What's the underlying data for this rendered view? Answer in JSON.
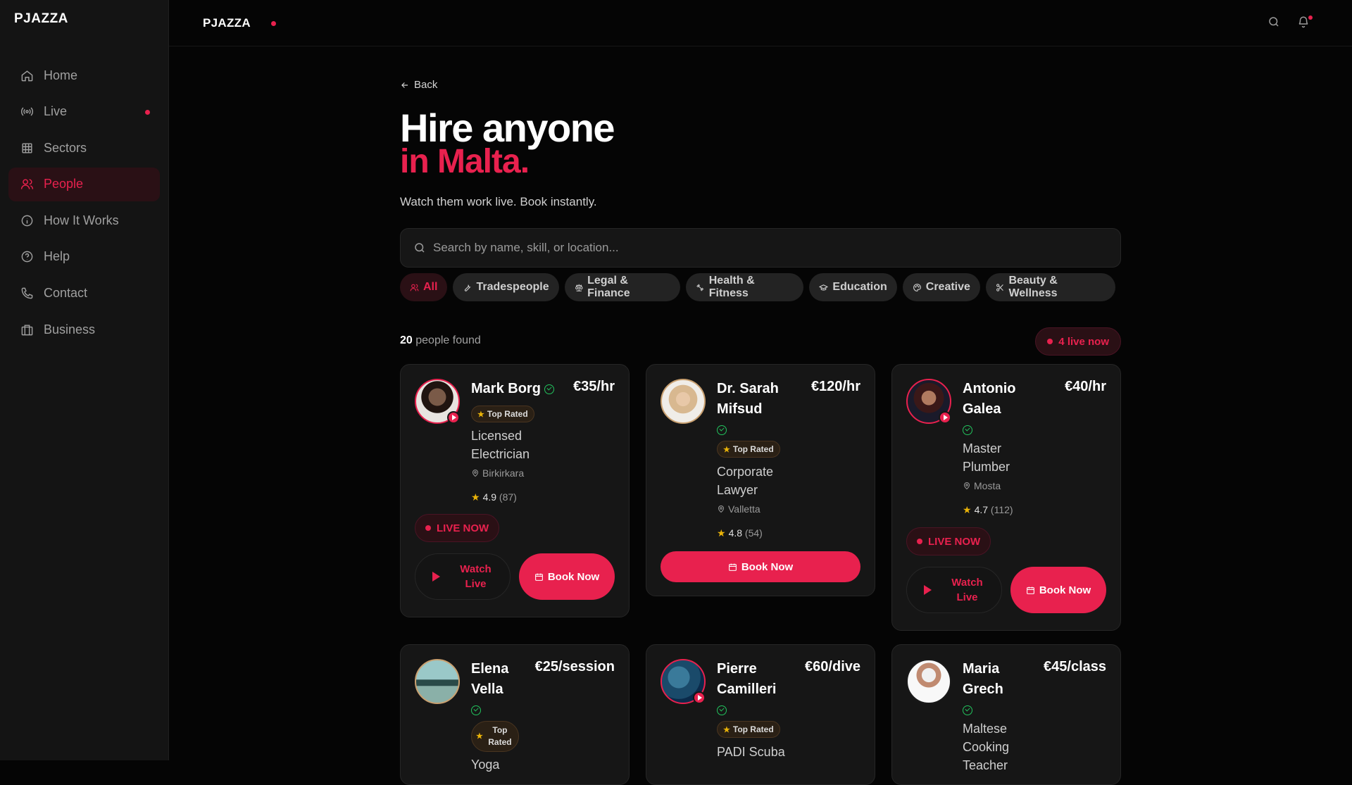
{
  "app": {
    "logo": "PJAZZA"
  },
  "sidebar": {
    "items": [
      {
        "label": "Home",
        "icon": "home-icon"
      },
      {
        "label": "Live",
        "icon": "broadcast-icon",
        "live": true
      },
      {
        "label": "Sectors",
        "icon": "grid-icon"
      },
      {
        "label": "People",
        "icon": "users-icon",
        "active": true
      },
      {
        "label": "How It Works",
        "icon": "info-icon"
      },
      {
        "label": "Help",
        "icon": "help-circle-icon"
      },
      {
        "label": "Contact",
        "icon": "phone-icon"
      },
      {
        "label": "Business",
        "icon": "briefcase-icon"
      }
    ]
  },
  "topbar": {
    "logo": "PJAZZA"
  },
  "page": {
    "back": "Back",
    "title_line1": "Hire anyone",
    "title_line2": "in Malta.",
    "subtitle": "Watch them work live. Book instantly.",
    "search_placeholder": "Search by name, skill, or location...",
    "categories": [
      {
        "label": "All",
        "icon": "users-icon",
        "active": true
      },
      {
        "label": "Tradespeople",
        "icon": "wrench-icon"
      },
      {
        "label": "Legal & Finance",
        "icon": "scale-icon"
      },
      {
        "label": "Health & Fitness",
        "icon": "dumbbell-icon"
      },
      {
        "label": "Education",
        "icon": "graduation-cap-icon"
      },
      {
        "label": "Creative",
        "icon": "palette-icon"
      },
      {
        "label": "Beauty & Wellness",
        "icon": "scissors-icon"
      }
    ],
    "found_count": "20",
    "found_label": "people found",
    "live_count": "4",
    "live_label": "live now"
  },
  "people": [
    {
      "name": "Mark Borg",
      "price": "€35/hr",
      "badge": "Top Rated",
      "job": "Licensed Electrician",
      "location": "Birkirkara",
      "rating": "4.9",
      "reviews": "(87)",
      "live": "LIVE NOW",
      "watch": "Watch Live",
      "book": "Book Now"
    },
    {
      "name": "Dr. Sarah Mifsud",
      "price": "€120/hr",
      "badge": "Top Rated",
      "job": "Corporate Lawyer",
      "location": "Valletta",
      "rating": "4.8",
      "reviews": "(54)",
      "book": "Book Now"
    },
    {
      "name": "Antonio Galea",
      "price": "€40/hr",
      "job": "Master Plumber",
      "location": "Mosta",
      "rating": "4.7",
      "reviews": "(112)",
      "live": "LIVE NOW",
      "watch": "Watch Live",
      "book": "Book Now"
    },
    {
      "name": "Elena Vella",
      "price": "€25/session",
      "badge": "Top Rated",
      "job": "Yoga"
    },
    {
      "name": "Pierre Camilleri",
      "price": "€60/dive",
      "badge": "Top Rated",
      "job": "PADI Scuba"
    },
    {
      "name": "Maria Grech",
      "price": "€45/class",
      "job": "Maltese Cooking Teacher"
    }
  ],
  "colors": {
    "accent": "#e8214e",
    "verify": "#22c55e",
    "star": "#eab308"
  }
}
